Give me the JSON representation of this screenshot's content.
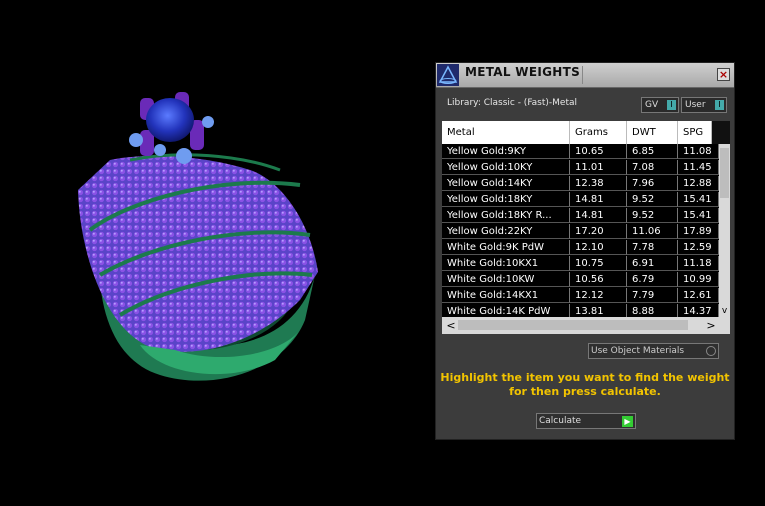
{
  "panel": {
    "title": "METAL WEIGHTS",
    "close_glyph": "×",
    "library_label": "Library: Classic - (Fast)-Metal",
    "toggles": [
      {
        "label": "GV",
        "knob": "I"
      },
      {
        "label": "User",
        "knob": "I"
      }
    ],
    "columns": [
      "Metal",
      "Grams",
      "DWT",
      "SPG"
    ],
    "rows": [
      {
        "metal": "Yellow Gold:9KY",
        "grams": "10.65",
        "dwt": "6.85",
        "spg": "11.08"
      },
      {
        "metal": "Yellow Gold:10KY",
        "grams": "11.01",
        "dwt": "7.08",
        "spg": "11.45"
      },
      {
        "metal": "Yellow Gold:14KY",
        "grams": "12.38",
        "dwt": "7.96",
        "spg": "12.88"
      },
      {
        "metal": "Yellow Gold:18KY",
        "grams": "14.81",
        "dwt": "9.52",
        "spg": "15.41"
      },
      {
        "metal": "Yellow Gold:18KY R...",
        "grams": "14.81",
        "dwt": "9.52",
        "spg": "15.41"
      },
      {
        "metal": "Yellow Gold:22KY",
        "grams": "17.20",
        "dwt": "11.06",
        "spg": "17.89"
      },
      {
        "metal": "White Gold:9K PdW",
        "grams": "12.10",
        "dwt": "7.78",
        "spg": "12.59"
      },
      {
        "metal": "White Gold:10KX1",
        "grams": "10.75",
        "dwt": "6.91",
        "spg": "11.18"
      },
      {
        "metal": "White Gold:10KW",
        "grams": "10.56",
        "dwt": "6.79",
        "spg": "10.99"
      },
      {
        "metal": "White Gold:14KX1",
        "grams": "12.12",
        "dwt": "7.79",
        "spg": "12.61"
      },
      {
        "metal": "White Gold:14K PdW",
        "grams": "13.81",
        "dwt": "8.88",
        "spg": "14.37"
      }
    ],
    "scroll": {
      "left": "<",
      "right": ">",
      "down": "v"
    },
    "use_object_materials": "Use Object Materials",
    "instruction_line1": "Highlight the item you want to find the weight",
    "instruction_line2": "for then press calculate.",
    "calculate_label": "Calculate",
    "calculate_arrow": "▶"
  }
}
